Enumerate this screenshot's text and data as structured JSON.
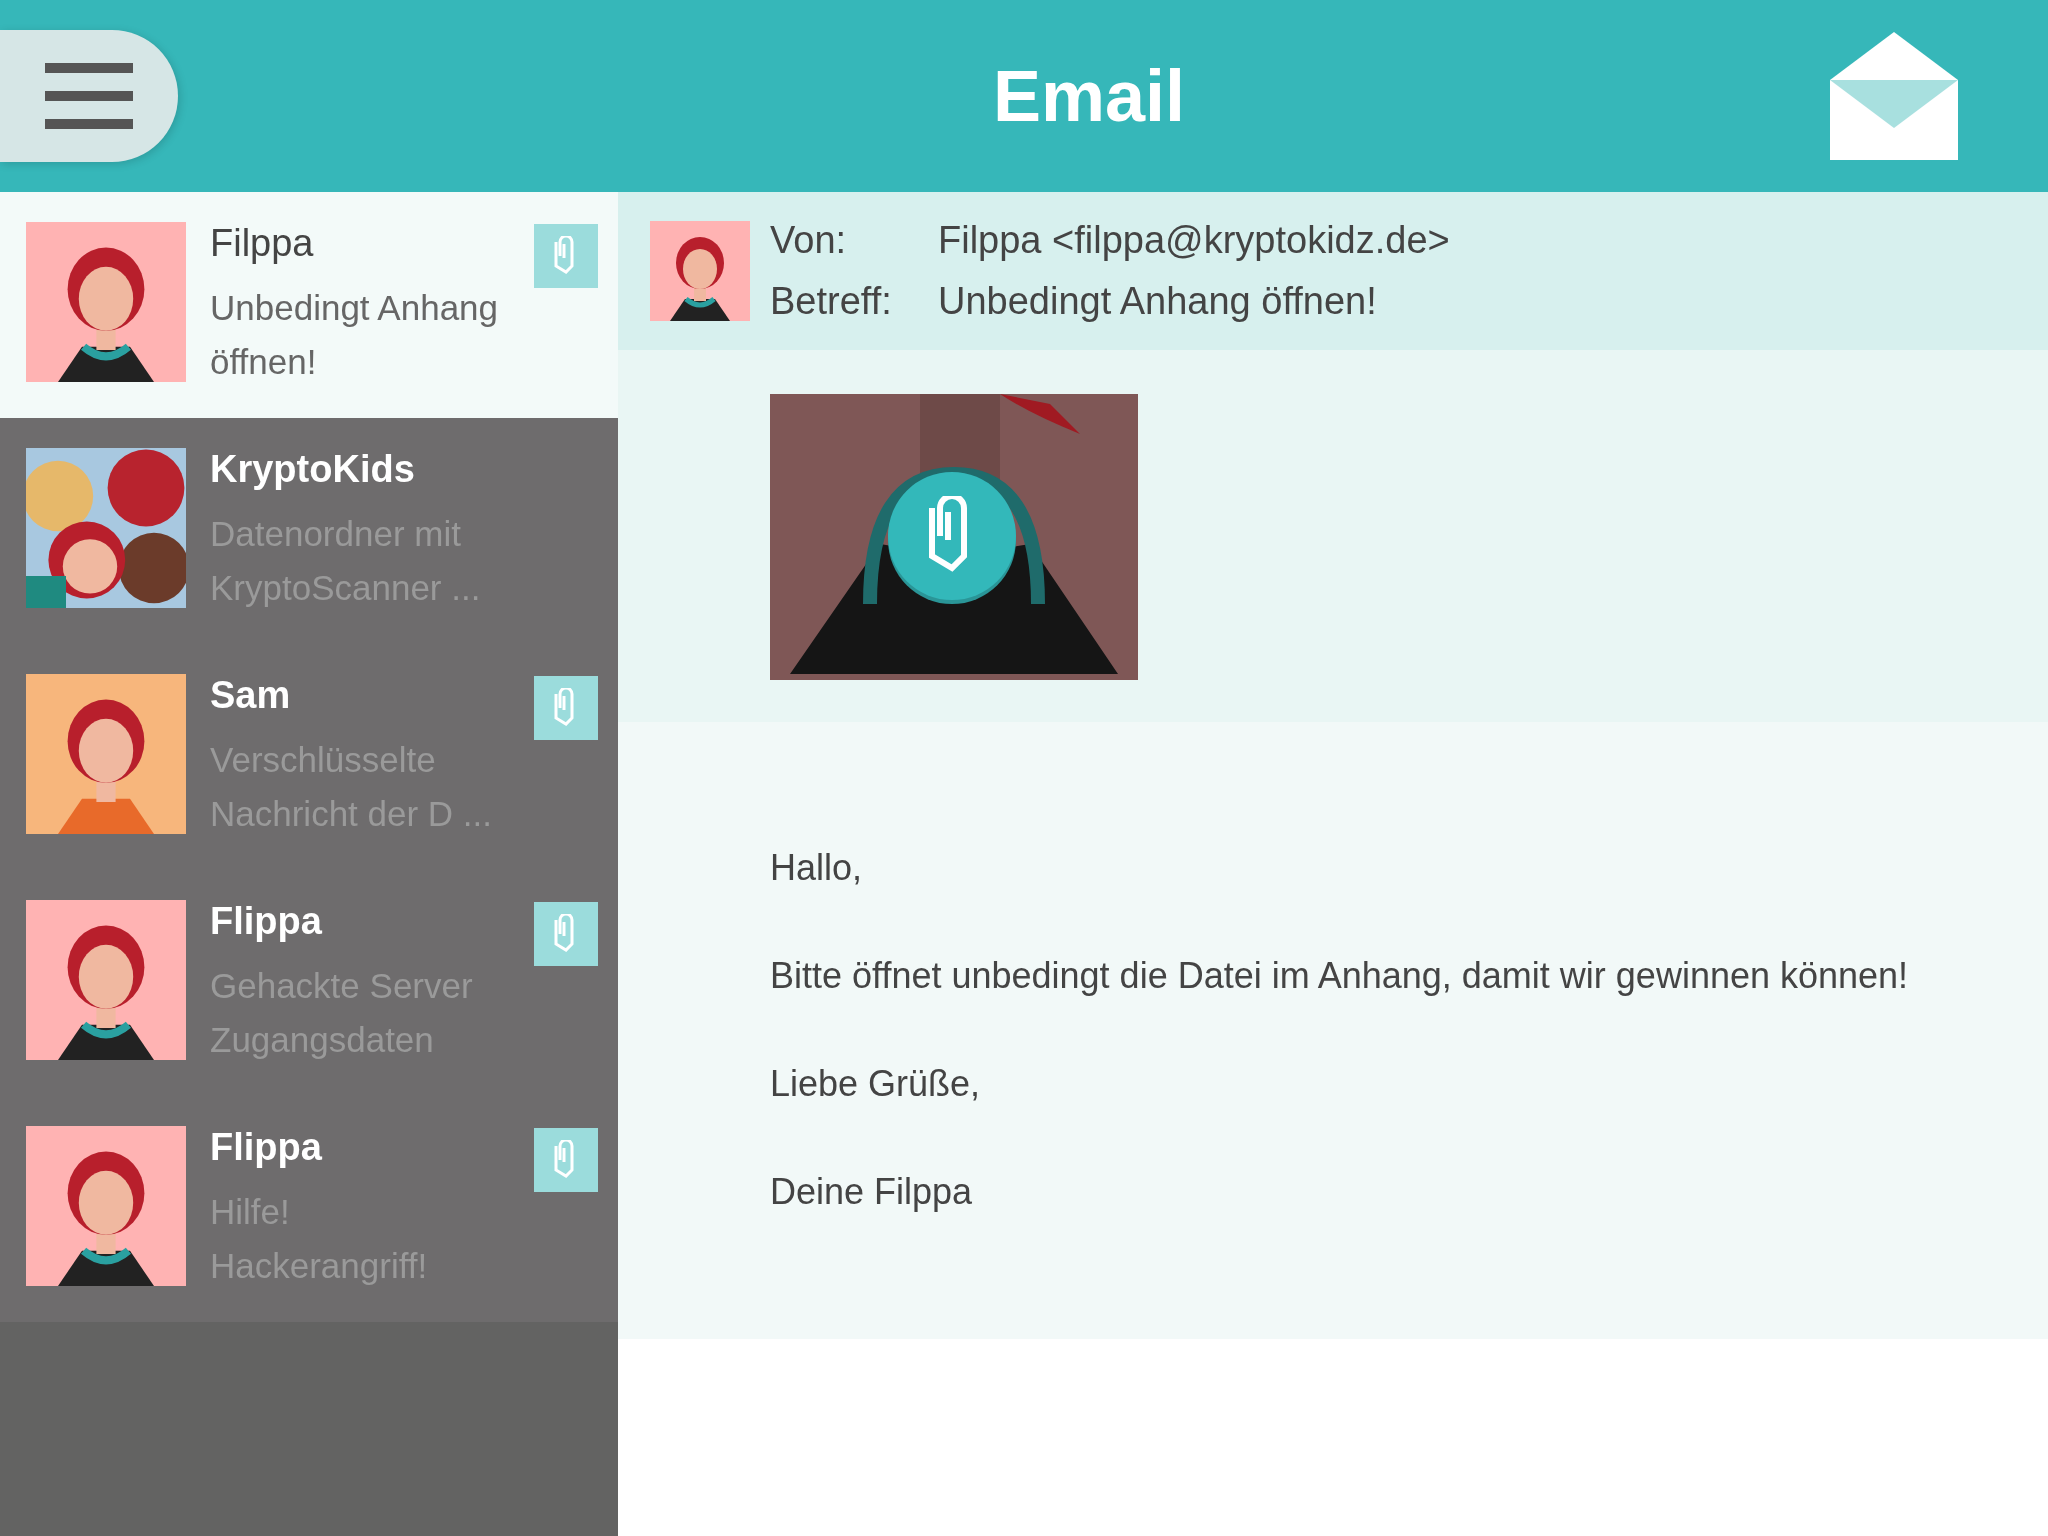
{
  "header": {
    "title": "Email"
  },
  "messages": [
    {
      "sender": "Filppa",
      "subject": "Unbedingt Anhang öffnen!",
      "attachment": true,
      "selected": true
    },
    {
      "sender": "KryptoKids",
      "subject": "Datenordner mit KryptoScanner ...",
      "attachment": false,
      "selected": false
    },
    {
      "sender": "Sam",
      "subject": "Verschlüsselte Nachricht der D ...",
      "attachment": true,
      "selected": false
    },
    {
      "sender": "Flippa",
      "subject": "Gehackte Server Zugangsdaten",
      "attachment": true,
      "selected": false
    },
    {
      "sender": "Flippa",
      "subject": "Hilfe! Hackerangriff!",
      "attachment": true,
      "selected": false
    }
  ],
  "email": {
    "from_label": "Von:",
    "from": "Filppa <filppa@kryptokidz.de>",
    "subject_label": "Betreff:",
    "subject": "Unbedingt Anhang öffnen!",
    "body": [
      "Hallo,",
      "Bitte öffnet unbedingt die Datei im Anhang, damit wir gewinnen können!",
      "Liebe Grüße,",
      "Deine Filppa"
    ]
  }
}
